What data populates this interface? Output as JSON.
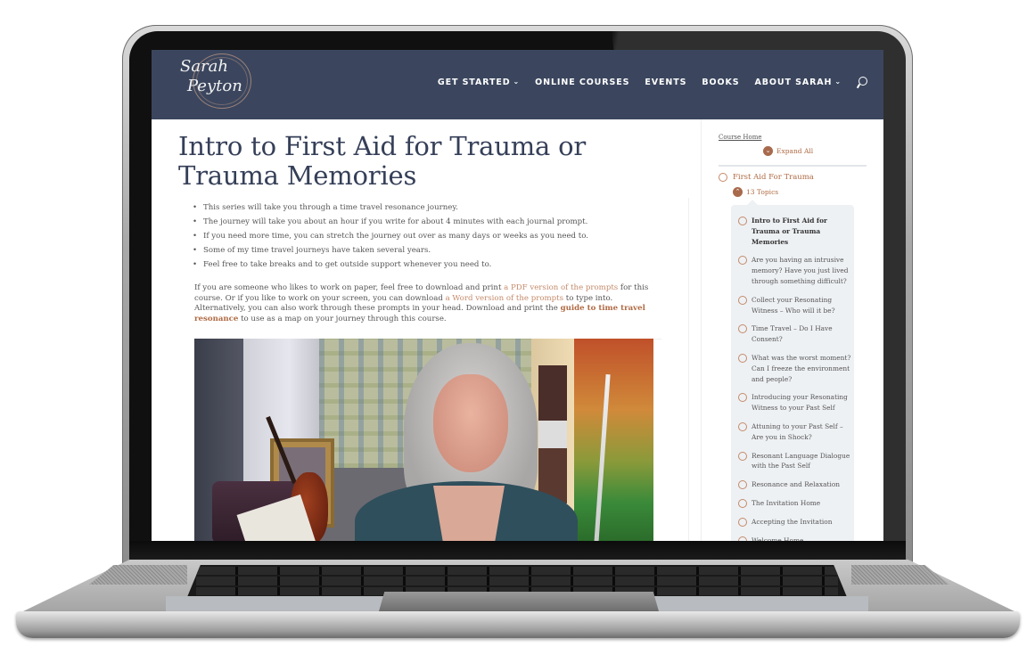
{
  "site": {
    "logo_line1": "Sarah",
    "logo_line2": "Peyton",
    "nav": [
      {
        "label": "GET STARTED",
        "has_dropdown": true
      },
      {
        "label": "ONLINE COURSES",
        "has_dropdown": false
      },
      {
        "label": "EVENTS",
        "has_dropdown": false
      },
      {
        "label": "BOOKS",
        "has_dropdown": false
      },
      {
        "label": "ABOUT SARAH",
        "has_dropdown": true
      }
    ],
    "dropdown_glyph": "⌄",
    "search_icon": "search-icon"
  },
  "main": {
    "title": "Intro to First Aid for Trauma or Trauma Memories",
    "bullets": [
      "This series will take you through a time travel resonance journey.",
      "The journey will take you about an hour if you write for about 4 minutes with each journal prompt.",
      "If you need more time, you can stretch the journey out over as many days or weeks as you need to.",
      "Some of my time travel journeys have taken several years.",
      "Feel free to take breaks and to get outside support whenever you need to."
    ],
    "paragraph": {
      "t1": "If you are someone who likes to work on paper, feel free to download and print ",
      "link1": "a PDF version of the prompts",
      "t2": " for this course. Or if you like to work on your screen, you can download ",
      "link2": "a Word version of the prompts",
      "t3": " to type into. Alternatively, you can also work through these prompts in your head. Download and print the ",
      "link3": "guide to time travel resonance",
      "t4": " to use as a map on your journey through this course."
    },
    "video": {
      "description": "Video of Sarah Peyton speaking"
    }
  },
  "sidebar": {
    "course_home": "Course Home",
    "expand_all": "Expand All",
    "lesson": "First Aid For Trauma",
    "topics_count": "13 Topics",
    "topics": [
      {
        "label": "Intro to First Aid for Trauma or Trauma Memories",
        "current": true
      },
      {
        "label": "Are you having an intrusive memory? Have you just lived through something difficult?",
        "current": false
      },
      {
        "label": "Collect your Resonating Witness – Who will it be?",
        "current": false
      },
      {
        "label": "Time Travel – Do I Have Consent?",
        "current": false
      },
      {
        "label": "What was the worst moment? Can I freeze the environment and people?",
        "current": false
      },
      {
        "label": "Introducing your Resonating Witness to your Past Self",
        "current": false
      },
      {
        "label": "Attuning to your Past Self – Are you in Shock?",
        "current": false
      },
      {
        "label": "Resonant Language Dialogue with the Past Self",
        "current": false
      },
      {
        "label": "Resonance and Relaxation",
        "current": false
      },
      {
        "label": "The Invitation Home",
        "current": false
      },
      {
        "label": "Accepting the Invitation",
        "current": false
      },
      {
        "label": "Welcome Home",
        "current": false
      }
    ]
  },
  "colors": {
    "header_bg": "#3b465e",
    "title": "#353f58",
    "accent_link": "#c48a6a",
    "accent_strong": "#b06a43",
    "topics_panel_bg": "#eef1f4"
  }
}
